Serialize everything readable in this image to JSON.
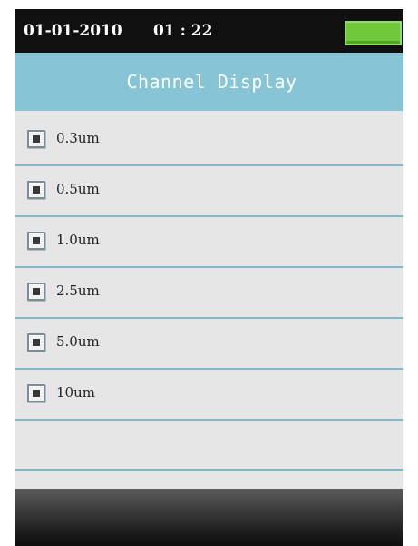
{
  "status_bar": {
    "date": "01-01-2010",
    "time": "01 : 22",
    "battery_icon": "battery-full-icon",
    "battery_color": "#6fc93a"
  },
  "title": "Channel Display",
  "channels": [
    {
      "label": "0.3um",
      "checked": true
    },
    {
      "label": "0.5um",
      "checked": true
    },
    {
      "label": "1.0um",
      "checked": true
    },
    {
      "label": "2.5um",
      "checked": true
    },
    {
      "label": "5.0um",
      "checked": true
    },
    {
      "label": "10um",
      "checked": true
    }
  ],
  "colors": {
    "status_bar_bg": "#101010",
    "title_bar_bg": "#86c4d6",
    "list_bg": "#e6e6e6",
    "row_divider": "#7fb7c8"
  }
}
